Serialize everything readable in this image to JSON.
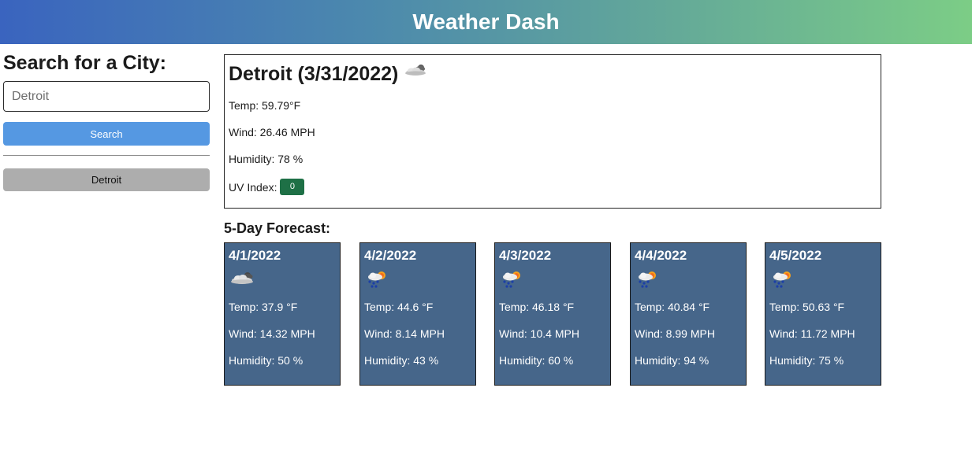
{
  "header": {
    "title": "Weather Dash"
  },
  "search": {
    "heading": "Search for a City:",
    "placeholder": "Detroit",
    "button_label": "Search",
    "history": [
      "Detroit"
    ]
  },
  "current": {
    "title": "Detroit (3/31/2022)",
    "icon": "cloud-icon",
    "temp": "Temp: 59.79°F",
    "wind": "Wind: 26.46 MPH",
    "humidity": "Humidity: 78 %",
    "uv_label": "UV Index:",
    "uv_value": "0",
    "uv_color": "#1e7046"
  },
  "forecast": {
    "title": "5-Day Forecast:",
    "card_color": "#46668a",
    "days": [
      {
        "date": "4/1/2022",
        "icon": "cloud-icon",
        "temp": "Temp: 37.9 °F",
        "wind": "Wind: 14.32 MPH",
        "humidity": "Humidity: 50 %"
      },
      {
        "date": "4/2/2022",
        "icon": "rain-sun-icon",
        "temp": "Temp: 44.6 °F",
        "wind": "Wind: 8.14 MPH",
        "humidity": "Humidity: 43 %"
      },
      {
        "date": "4/3/2022",
        "icon": "rain-sun-icon",
        "temp": "Temp: 46.18 °F",
        "wind": "Wind: 10.4 MPH",
        "humidity": "Humidity: 60 %"
      },
      {
        "date": "4/4/2022",
        "icon": "rain-sun-icon",
        "temp": "Temp: 40.84 °F",
        "wind": "Wind: 8.99 MPH",
        "humidity": "Humidity: 94 %"
      },
      {
        "date": "4/5/2022",
        "icon": "rain-sun-icon",
        "temp": "Temp: 50.63 °F",
        "wind": "Wind: 11.72 MPH",
        "humidity": "Humidity: 75 %"
      }
    ]
  }
}
